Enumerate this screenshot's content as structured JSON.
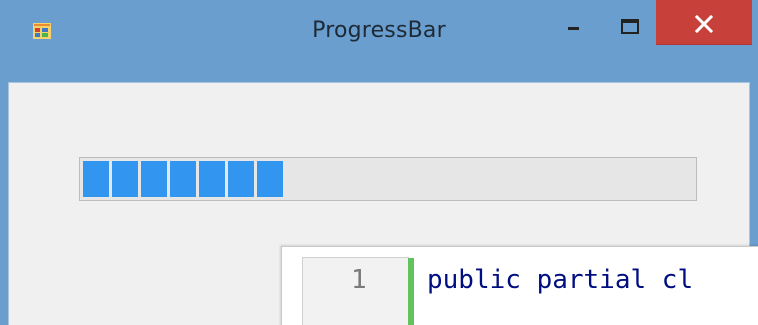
{
  "window": {
    "title": "ProgressBar",
    "icon": "winforms-app-icon",
    "controls": {
      "minimize_icon": "minimize-icon",
      "maximize_icon": "maximize-icon",
      "close_icon": "close-icon"
    },
    "colors": {
      "titlebar": "#6a9ecf",
      "close": "#c7413a",
      "client": "#f0f0f0",
      "progress_fill": "#3295ef"
    }
  },
  "progress_bar": {
    "style": "blocks",
    "visible_filled_blocks": 7,
    "progress_fraction": 0.33
  },
  "code_editor": {
    "line_number": "1",
    "code_text": "public partial cl"
  }
}
